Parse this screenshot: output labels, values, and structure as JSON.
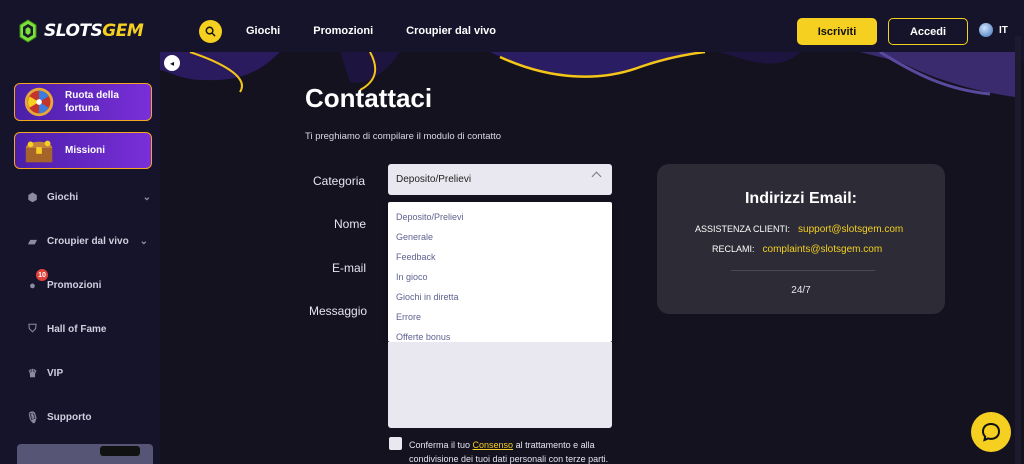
{
  "header": {
    "logo_text_1": "SLOTS",
    "logo_text_2": "GEM",
    "nav": [
      "Giochi",
      "Promozioni",
      "Croupier dal vivo"
    ],
    "signup_label": "Iscriviti",
    "login_label": "Accedi",
    "language": "IT"
  },
  "sidebar": {
    "collapse_icon": "◂",
    "promo_cards": [
      {
        "label": "Ruota della fortuna",
        "icon": "wheel-icon"
      },
      {
        "label": "Missioni",
        "icon": "treasure-chest-icon"
      }
    ],
    "items": [
      {
        "label": "Giochi",
        "icon": "dice-icon",
        "has_chevron": true
      },
      {
        "label": "Croupier dal vivo",
        "icon": "cards-icon",
        "has_chevron": true
      },
      {
        "label": "Promozioni",
        "icon": "gift-icon",
        "badge": "10"
      },
      {
        "label": "Hall of Fame",
        "icon": "shield-icon"
      },
      {
        "label": "VIP",
        "icon": "crown-icon"
      },
      {
        "label": "Supporto",
        "icon": "microphone-icon"
      }
    ]
  },
  "main": {
    "title": "Contattaci",
    "subtitle": "Ti preghiamo di compilare il modulo di contatto",
    "form": {
      "category_label": "Categoria",
      "category_value": "Deposito/Prelievi",
      "name_label": "Nome",
      "email_label": "E-mail",
      "message_label": "Messaggio",
      "category_options": [
        "Deposito/Prelievi",
        "Generale",
        "Feedback",
        "In gioco",
        "Giochi in diretta",
        "Errore",
        "Offerte bonus"
      ],
      "consent_before": "Conferma il tuo ",
      "consent_link": "Consenso",
      "consent_after": " al trattamento e alla condivisione dei tuoi dati personali con terze parti."
    },
    "email_card": {
      "title": "Indirizzi Email:",
      "support_label": "ASSISTENZA CLIENTI:",
      "support_email": "support@slotsgem.com",
      "complaints_label": "RECLAMI:",
      "complaints_email": "complaints@slotsgem.com",
      "hours": "24/7"
    }
  },
  "colors": {
    "accent": "#f5d020",
    "background": "#14121f",
    "card": "#2c2b36",
    "promo_purple": "#6b2bd1"
  }
}
